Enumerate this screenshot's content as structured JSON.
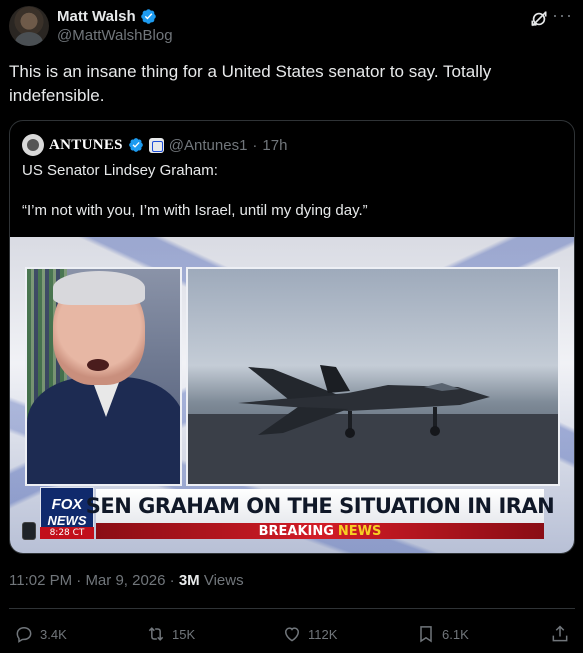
{
  "author": {
    "display_name": "Matt Walsh",
    "handle": "@MattWalshBlog"
  },
  "tweet_text": "This is an insane thing for a United States senator to say. Totally indefensible.",
  "quote": {
    "display_name": "ANTUNES",
    "handle": "@Antunes1",
    "separator": "·",
    "time_ago": "17h",
    "line1": "US Senator Lindsey Graham:",
    "line2": "“I’m not with you, I’m with Israel, until my dying day.”",
    "video": {
      "logo_top": "FOX",
      "logo_bottom": "NEWS",
      "clock": "8:28 CT",
      "headline": "SEN GRAHAM ON THE SITUATION IN IRAN",
      "banner_word1": "BREAKING",
      "banner_word2": "NEWS"
    }
  },
  "meta": {
    "time": "11:02 PM",
    "separator": "·",
    "date": "Mar 9, 2026",
    "separator2": "·",
    "views_count": "3M",
    "views_label": "Views"
  },
  "actions": {
    "replies": "3.4K",
    "reposts": "15K",
    "likes": "112K",
    "bookmarks": "6.1K"
  },
  "colors": {
    "background": "#000000",
    "text": "#e7e9ea",
    "muted": "#71767b",
    "verified": "#1d9bf0",
    "border": "#2f3336"
  },
  "icons": {
    "more": "more-icon",
    "grok": "grok-icon",
    "reply": "reply-icon",
    "repost": "repost-icon",
    "like": "like-icon",
    "bookmark": "bookmark-icon",
    "share": "share-icon"
  }
}
